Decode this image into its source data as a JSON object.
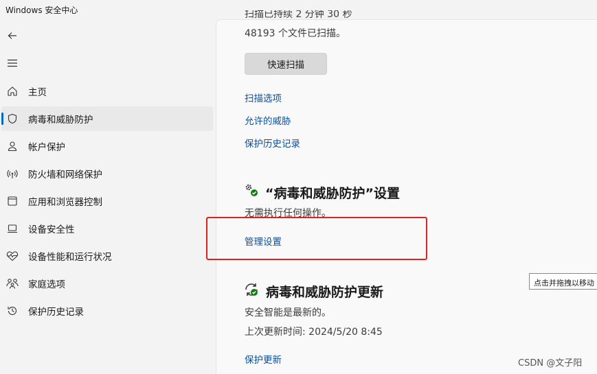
{
  "window": {
    "title": "Windows 安全中心"
  },
  "sidebar": {
    "back_icon": "back-arrow-icon",
    "menu_icon": "hamburger-menu-icon",
    "items": [
      {
        "label": "主页",
        "icon": "home-icon"
      },
      {
        "label": "病毒和威胁防护",
        "icon": "shield-icon",
        "active": true
      },
      {
        "label": "帐户保护",
        "icon": "person-icon"
      },
      {
        "label": "防火墙和网络保护",
        "icon": "wifi-antenna-icon"
      },
      {
        "label": "应用和浏览器控制",
        "icon": "app-window-icon"
      },
      {
        "label": "设备安全性",
        "icon": "laptop-icon"
      },
      {
        "label": "设备性能和运行状况",
        "icon": "heart-pulse-icon"
      },
      {
        "label": "家庭选项",
        "icon": "family-icon"
      },
      {
        "label": "保护历史记录",
        "icon": "history-icon"
      }
    ]
  },
  "scan": {
    "cut_off_line": "扫描已持续 2 分钟 30 秒",
    "files_scanned": "48193 个文件已扫描。",
    "quick_scan_label": "快速扫描",
    "links": [
      "扫描选项",
      "允许的威胁",
      "保护历史记录"
    ]
  },
  "settings_section": {
    "icon": "gear-check-icon",
    "title": "“病毒和威胁防护”设置",
    "status": "无需执行任何操作。",
    "manage_link": "管理设置"
  },
  "updates_section": {
    "icon": "refresh-check-icon",
    "title": "病毒和威胁防护更新",
    "status": "安全智能是最新的。",
    "last_update": "上次更新时间: 2024/5/20 8:45",
    "update_link": "保护更新"
  },
  "tooltip": {
    "text": "点击并拖拽以移动"
  },
  "watermark": {
    "text": "CSDN @文子阳"
  },
  "colors": {
    "accent": "#0067c0",
    "link": "#0e4f99",
    "highlight_box": "#e02020",
    "success_green": "#107c10"
  }
}
